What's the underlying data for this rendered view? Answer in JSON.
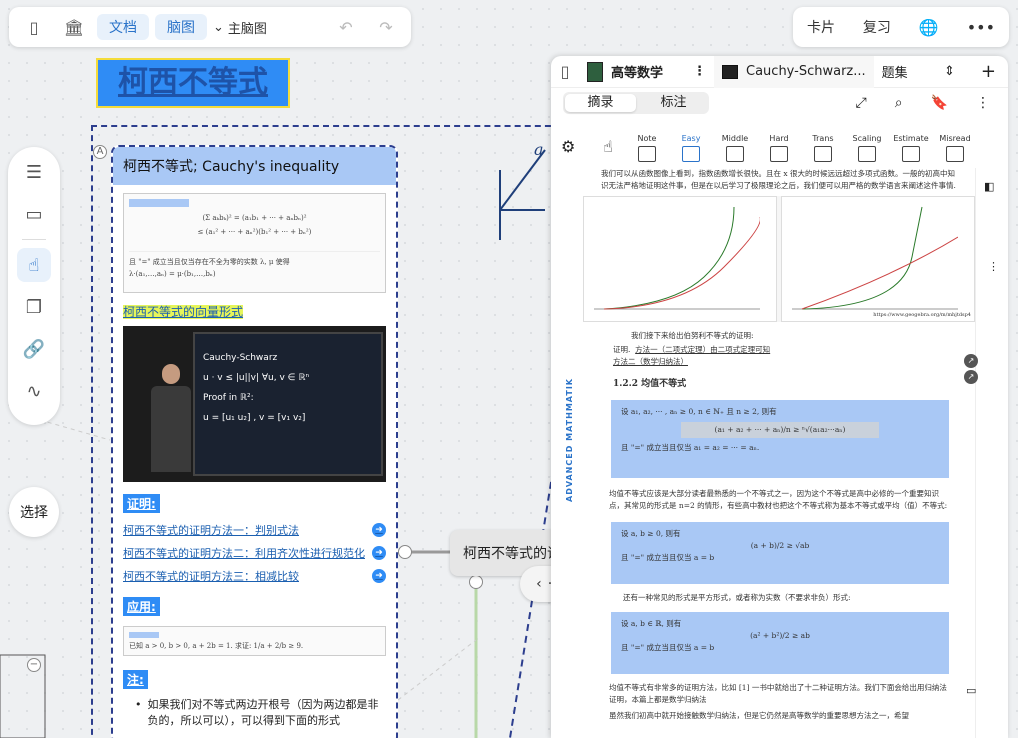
{
  "toolbar": {
    "doc_label": "文档",
    "mindmap_label": "脑图",
    "mainmap_label": "主脑图",
    "card_label": "卡片",
    "review_label": "复习"
  },
  "sidebar": {
    "select_label": "选择"
  },
  "canvas": {
    "title_node": "柯西不等式",
    "secondary_node": "柯西不等式的证"
  },
  "card": {
    "title": "柯西不等式; Cauchy's inequality",
    "vector_heading": "柯西不等式的向量形式",
    "proof_tag": "证明:",
    "links": [
      "柯西不等式的证明方法一：判别式法",
      "柯西不等式的证明方法二：利用齐次性进行规范化",
      "柯西不等式的证明方法三：相减比较"
    ],
    "apply_tag": "应用:",
    "note_tag": "注:",
    "note_text": "如果我们对不等式两边开根号（因为两边都是非负的，所以可以），可以得到下面的形式",
    "video": {
      "line1": "Cauchy-Schwarz",
      "line2": "u · v ≤ |u||v|   ∀u, v ∈ ℝⁿ",
      "line3": "Proof in ℝ²:",
      "line4": "u = [u₁ u₂] , v = [v₁ v₂]"
    }
  },
  "panel": {
    "tab1": "高等数学",
    "tab2": "Cauchy-Schwarz...",
    "tab3": "题集",
    "seg": [
      "摘录",
      "标注"
    ],
    "tools": [
      "Note",
      "Easy",
      "Middle",
      "Hard",
      "Trans",
      "Scaling",
      "Estimate",
      "Misread"
    ],
    "doc": {
      "intro": "我们可以从函数图像上看到，指数函数增长很快。且在 x 很大的时候远远超过多项式函数。一般的初高中知识无法严格地证明这件事，但是在以后学习了极限理论之后，我们便可以用严格的数学语言来阐述这件事情.",
      "source": "https://www.geogebra.org/m/mhjtdsp4",
      "lead": "我们接下来给出伯努利不等式的证明:",
      "proof_label": "证明.",
      "method1": "方法一（二项式定理）由二项式定理可知",
      "method2": "方法二（数学归纳法）",
      "section": "1.2.2   均值不等式",
      "side_label": "ADVANCED MATHMATIK",
      "p1": "均值不等式应该是大部分读者最熟悉的一个不等式之一，因为这个不等式是高中必修的一个重要知识点，其常见的形式是 n=2 的情形，有些高中教材也把这个不等式称为基本不等式或平均（值）不等式:",
      "p2": "还有一种常见的形式是平方形式，或者称为实数（不要求非负）形式:",
      "p3": "均值不等式有非常多的证明方法，比如 [1] 一书中就给出了十二种证明方法。我们下面会给出用归纳法证明，本篇上都是数学归纳法",
      "p4": "虽然我们初高中就开始接触数学归纳法，但是它仍然是高等数学的重要思想方法之一，希望",
      "box1": [
        "设 a₁, a₂, ··· , aₙ ≥ 0, n ∈ ℕ₊ 且 n ≥ 2, 则有",
        "(a₁ + a₂ + ··· + aₙ)/n ≥ ⁿ√(a₁a₂···aₙ)",
        "且 \"=\" 成立当且仅当 a₁ = a₂ = ··· = aₙ."
      ],
      "box2": [
        "设 a, b ≥ 0, 则有",
        "(a + b)/2 ≥ √ab",
        "且 \"=\" 成立当且仅当 a = b"
      ],
      "box3": [
        "设 a, b ∈ ℝ, 则有",
        "(a² + b²)/2 ≥ ab",
        "且 \"=\" 成立当且仅当 a = b"
      ]
    }
  }
}
